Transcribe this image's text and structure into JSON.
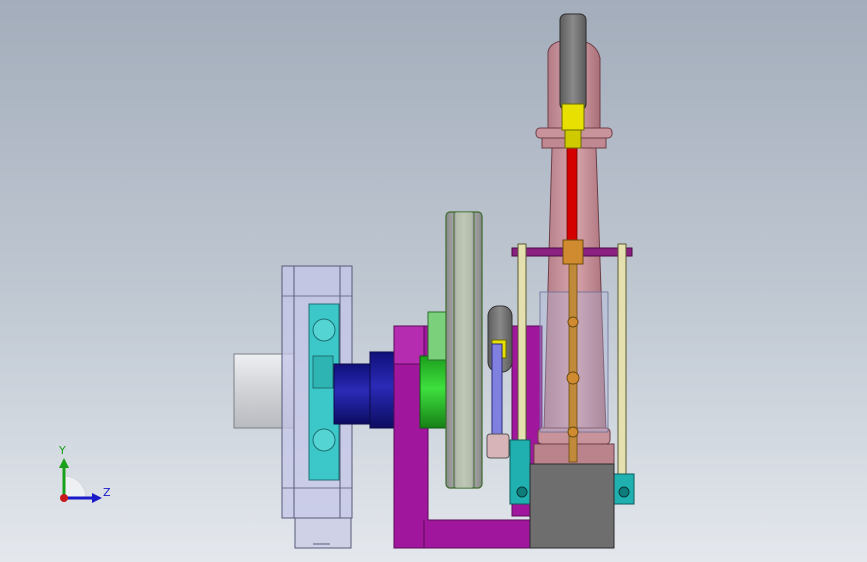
{
  "viewport": {
    "background_top": "#a3adbb",
    "background_bottom": "#e4e8ed",
    "model": {
      "parts": [
        {
          "name": "shaft-stub",
          "color": "#d8d9dd"
        },
        {
          "name": "flywheel-housing",
          "color": "#c4c6e8"
        },
        {
          "name": "inner-disc",
          "color": "#3cc8c8"
        },
        {
          "name": "hub",
          "color": "#1d1d9c"
        },
        {
          "name": "green-bushing",
          "color": "#2ec82e"
        },
        {
          "name": "pulley",
          "color": "#a8a8a8"
        },
        {
          "name": "frame-bracket",
          "color": "#a0169c"
        },
        {
          "name": "crank-wheel",
          "color": "#7a7a7a"
        },
        {
          "name": "connecting-rod",
          "color": "#8080e0"
        },
        {
          "name": "column",
          "color": "#c8939b"
        },
        {
          "name": "piston-rod",
          "color": "#d40000"
        },
        {
          "name": "crosshead-bar",
          "color": "#8a2080"
        },
        {
          "name": "guide-rails",
          "color": "#d8d4a0"
        },
        {
          "name": "base-block",
          "color": "#6e6e6e"
        },
        {
          "name": "teal-clamps",
          "color": "#20b0b0"
        },
        {
          "name": "yellow-fittings",
          "color": "#e8e000"
        }
      ]
    }
  },
  "triad": {
    "y_label": "Y",
    "z_label": "Z",
    "y_color": "#1aa01a",
    "z_color": "#1a1ac8",
    "origin_color": "#c81a1a"
  }
}
